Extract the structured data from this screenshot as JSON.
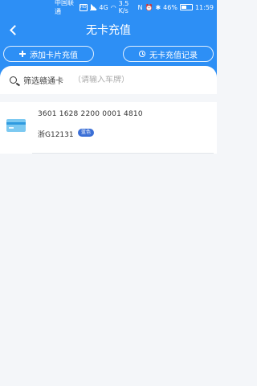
{
  "status_bar": {
    "carrier": "中国联通",
    "carrier_badge": "HD",
    "network": "4G",
    "speed": "3.5 K/s",
    "battery": "46%",
    "time": "11:59"
  },
  "navbar": {
    "back_icon": "chevron-left-icon",
    "title": "无卡充值"
  },
  "actions": {
    "add_card_label": "添加卡片充值",
    "add_icon": "plus-icon",
    "records_label": "无卡充值记录",
    "records_icon": "clock-icon"
  },
  "search": {
    "icon": "search-icon",
    "label": "筛选赣通卡",
    "placeholder": "（请输入车牌）",
    "value": ""
  },
  "cards": [
    {
      "icon": "card-icon",
      "number": "3601 1628 2200 0001 4810",
      "plate": "浙G12131",
      "plate_color": "蓝色",
      "badge_color": "#3b6fd6"
    }
  ],
  "colors": {
    "header_blue": "#2d8ff5",
    "page_background": "#f4f6f9"
  }
}
